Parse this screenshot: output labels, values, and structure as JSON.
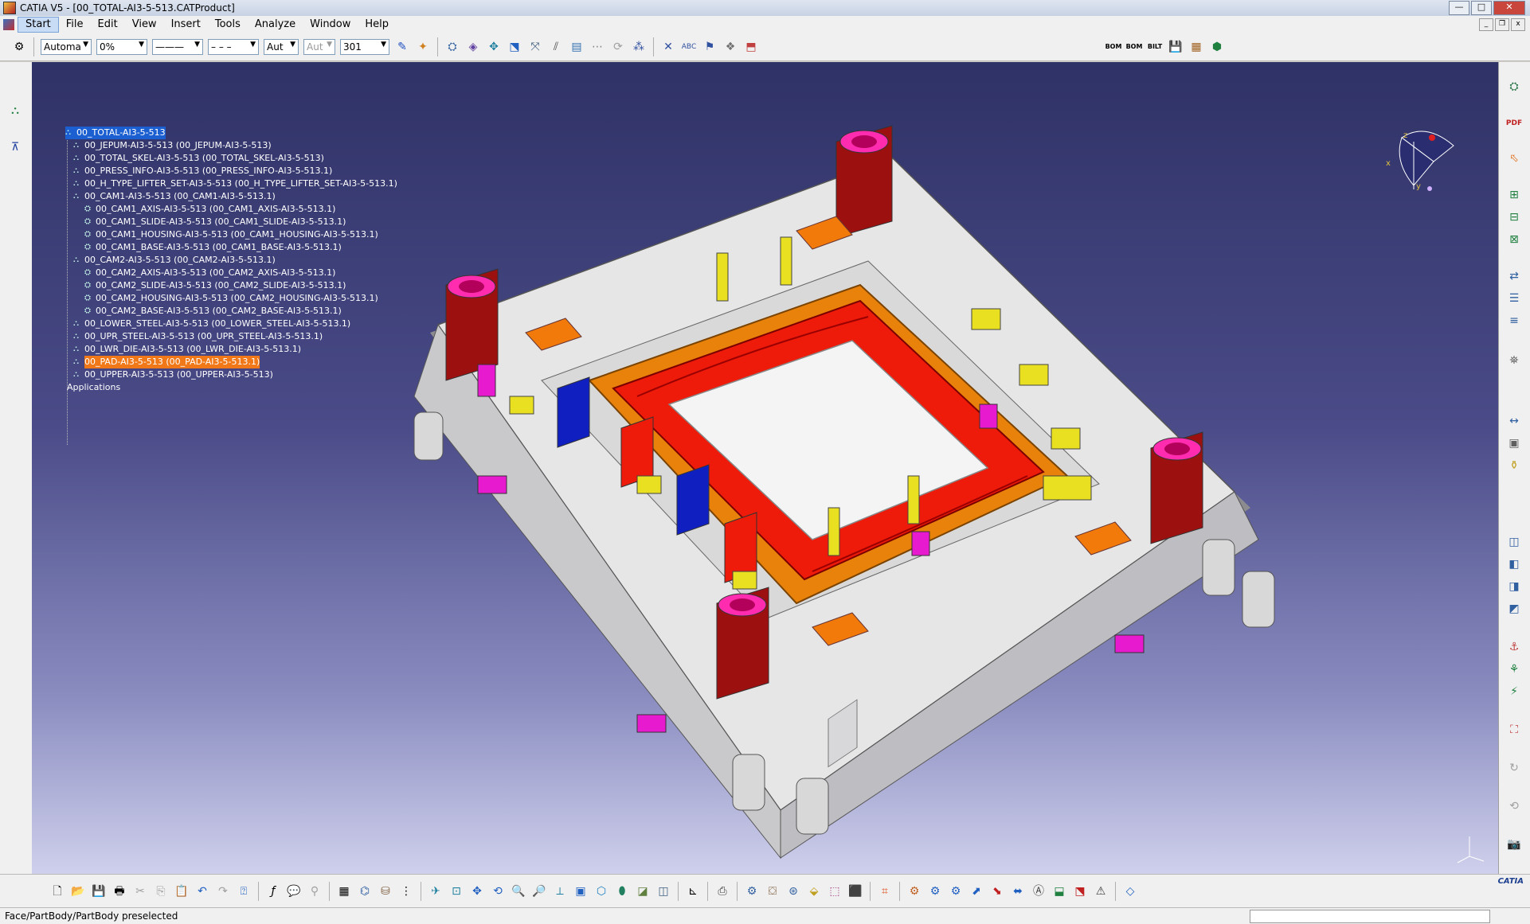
{
  "window": {
    "title": "CATIA V5 - [00_TOTAL-AI3-5-513.CATProduct]",
    "min": "—",
    "max": "□",
    "close": "✕"
  },
  "menu": {
    "items": [
      "Start",
      "File",
      "Edit",
      "View",
      "Insert",
      "Tools",
      "Analyze",
      "Window",
      "Help"
    ]
  },
  "toolbar": {
    "combo_mode": "Automa",
    "combo_percent": "0%",
    "combo_auto": "Aut",
    "combo_auto2": "Aut",
    "combo_layer": "301"
  },
  "tree": {
    "root": "00_TOTAL-AI3-5-513",
    "items": [
      "00_JEPUM-AI3-5-513 (00_JEPUM-AI3-5-513)",
      "00_TOTAL_SKEL-AI3-5-513 (00_TOTAL_SKEL-AI3-5-513)",
      "00_PRESS_INFO-AI3-5-513 (00_PRESS_INFO-AI3-5-513.1)",
      "00_H_TYPE_LIFTER_SET-AI3-5-513 (00_H_TYPE_LIFTER_SET-AI3-5-513.1)",
      "00_CAM1-AI3-5-513 (00_CAM1-AI3-5-513.1)",
      "00_CAM1_AXIS-AI3-5-513 (00_CAM1_AXIS-AI3-5-513.1)",
      "00_CAM1_SLIDE-AI3-5-513 (00_CAM1_SLIDE-AI3-5-513.1)",
      "00_CAM1_HOUSING-AI3-5-513 (00_CAM1_HOUSING-AI3-5-513.1)",
      "00_CAM1_BASE-AI3-5-513 (00_CAM1_BASE-AI3-5-513.1)",
      "00_CAM2-AI3-5-513 (00_CAM2-AI3-5-513.1)",
      "00_CAM2_AXIS-AI3-5-513 (00_CAM2_AXIS-AI3-5-513.1)",
      "00_CAM2_SLIDE-AI3-5-513 (00_CAM2_SLIDE-AI3-5-513.1)",
      "00_CAM2_HOUSING-AI3-5-513 (00_CAM2_HOUSING-AI3-5-513.1)",
      "00_CAM2_BASE-AI3-5-513 (00_CAM2_BASE-AI3-5-513.1)",
      "00_LOWER_STEEL-AI3-5-513 (00_LOWER_STEEL-AI3-5-513.1)",
      "00_UPR_STEEL-AI3-5-513 (00_UPR_STEEL-AI3-5-513.1)",
      "00_LWR_DIE-AI3-5-513 (00_LWR_DIE-AI3-5-513.1)",
      "00_PAD-AI3-5-513 (00_PAD-AI3-5-513.1)",
      "00_UPPER-AI3-5-513 (00_UPPER-AI3-5-513)"
    ],
    "applications": "Applications"
  },
  "toolbar_top_labels": {
    "bom1": "BOM",
    "bom2": "BOM",
    "bilt": "BILT"
  },
  "status": {
    "text": "Face/PartBody/PartBody preselected"
  },
  "colors": {
    "accent": "#1c5fd0",
    "highlight": "#f07818",
    "viewport_top": "#2f3266",
    "viewport_bottom": "#cfd0ec"
  },
  "logo": "CATIA",
  "compass_labels": {
    "x": "x",
    "y": "y",
    "z": "z"
  }
}
